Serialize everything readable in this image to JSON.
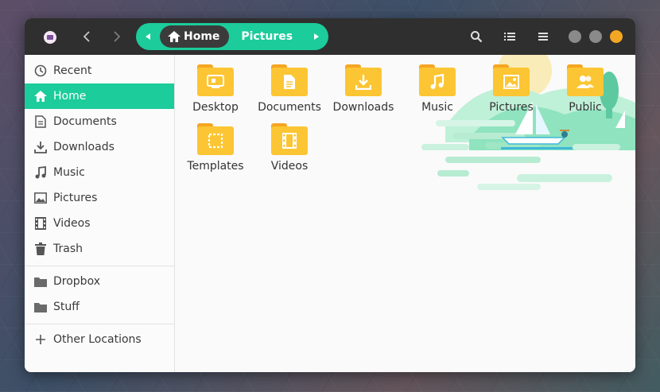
{
  "colors": {
    "accent": "#1ccc9a",
    "headerbar": "#2f2f2f",
    "folder": "#fcc533",
    "folder_dark": "#f5a623",
    "window_close": "#f5a623",
    "window_buttons": "#8a8a8a"
  },
  "header": {
    "app_icon": "files-app-icon",
    "path": {
      "home_label": "Home",
      "current_label": "Pictures"
    },
    "icons": [
      "search-icon",
      "list-view-icon",
      "menu-icon"
    ]
  },
  "sidebar": {
    "items": [
      {
        "label": "Recent",
        "icon": "clock-icon"
      },
      {
        "label": "Home",
        "icon": "home-icon",
        "active": true
      },
      {
        "label": "Documents",
        "icon": "document-icon"
      },
      {
        "label": "Downloads",
        "icon": "download-icon"
      },
      {
        "label": "Music",
        "icon": "music-icon"
      },
      {
        "label": "Pictures",
        "icon": "picture-icon"
      },
      {
        "label": "Videos",
        "icon": "film-icon"
      },
      {
        "label": "Trash",
        "icon": "trash-icon"
      }
    ],
    "bookmarks": [
      {
        "label": "Dropbox",
        "icon": "folder-icon"
      },
      {
        "label": "Stuff",
        "icon": "folder-icon"
      }
    ],
    "other": {
      "label": "Other Locations",
      "icon": "plus-icon"
    }
  },
  "folders": [
    {
      "label": "Desktop",
      "icon": "desktop-icon"
    },
    {
      "label": "Documents",
      "icon": "document-icon"
    },
    {
      "label": "Downloads",
      "icon": "download-icon"
    },
    {
      "label": "Music",
      "icon": "music-icon"
    },
    {
      "label": "Pictures",
      "icon": "picture-icon"
    },
    {
      "label": "Public",
      "icon": "people-icon"
    },
    {
      "label": "Templates",
      "icon": "template-icon"
    },
    {
      "label": "Videos",
      "icon": "film-icon"
    }
  ]
}
